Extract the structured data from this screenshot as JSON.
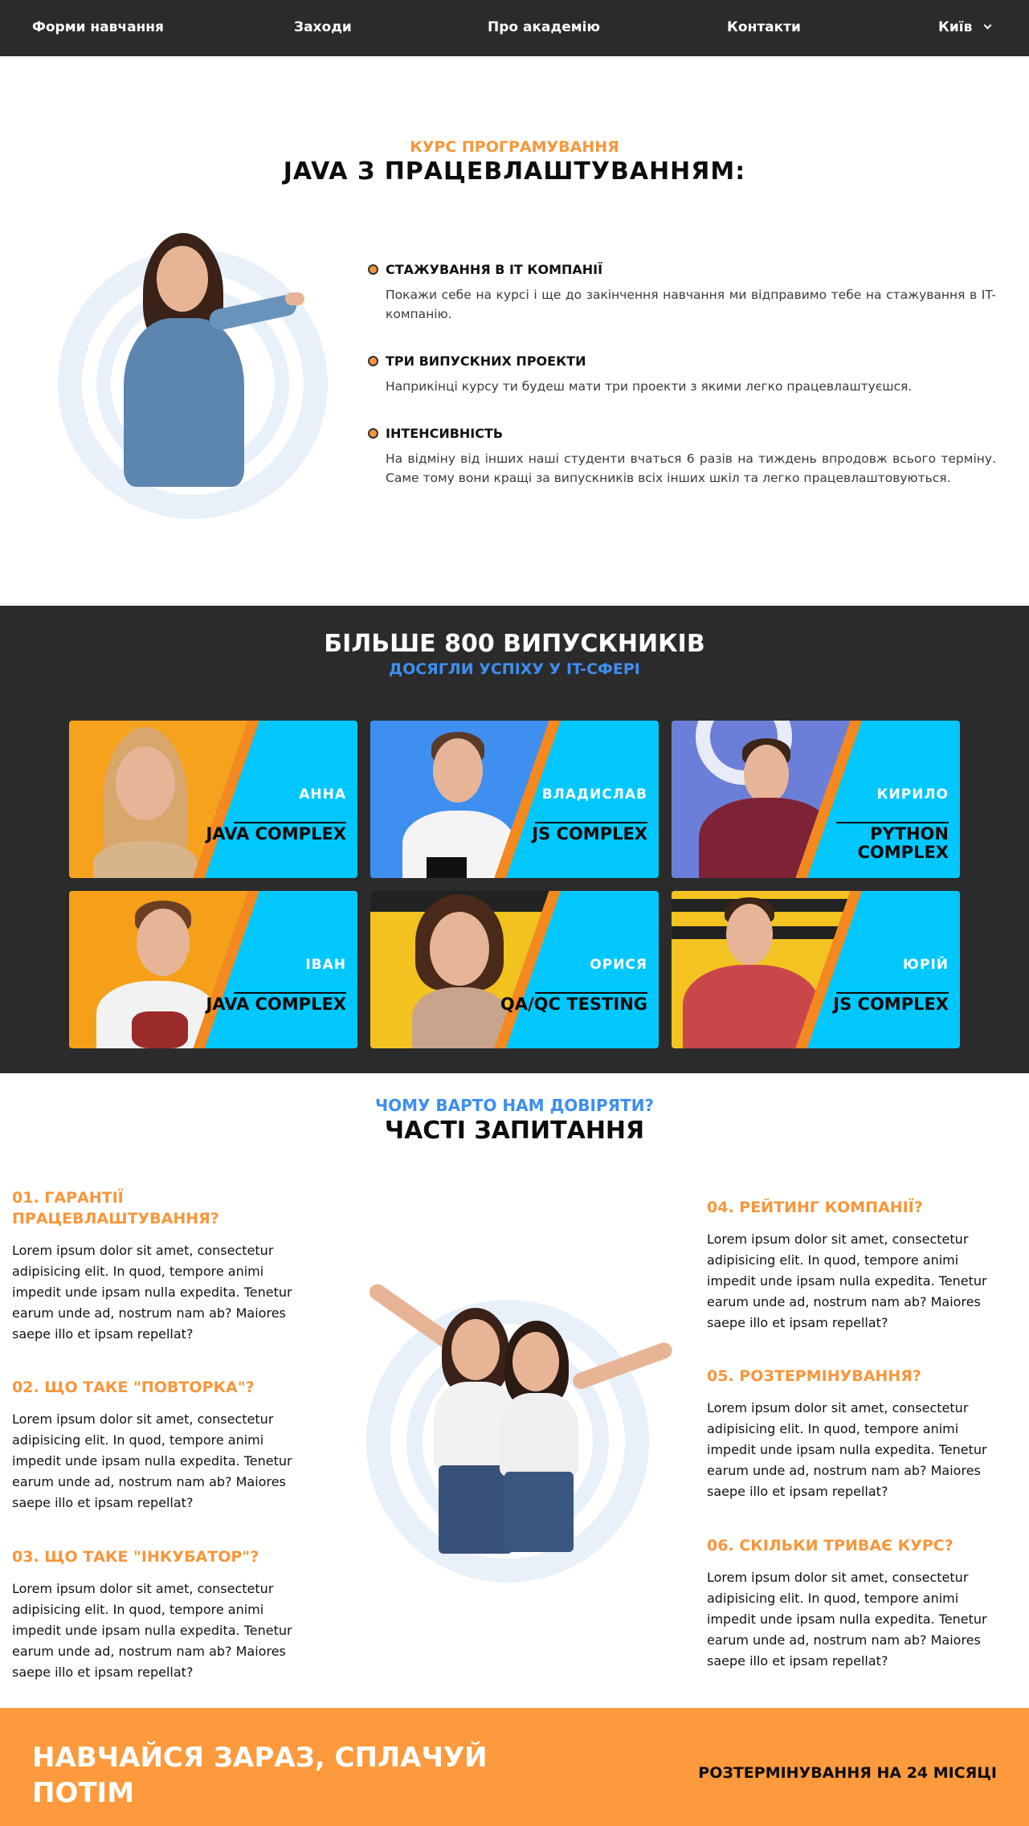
{
  "nav": {
    "items": [
      "Форми навчання",
      "Заходи",
      "Про академію",
      "Контакти"
    ],
    "city": "Київ"
  },
  "course": {
    "subtitle": "КУРС ПРОГРАМУВАННЯ",
    "title": "JAVA З ПРАЦЕВЛАШТУВАННЯМ:",
    "features": [
      {
        "title": "СТАЖУВАННЯ В IT КОМПАНІЇ",
        "text": "Покажи себе на курсі і ще до закінчення навчання ми відправимо тебе на стажування в IT-компанію."
      },
      {
        "title": "ТРИ ВИПУСКНИХ ПРОЕКТИ",
        "text": "Наприкінці курсу ти будеш мати три проекти з якими легко працевлаштуєшся."
      },
      {
        "title": "ІНТЕНСИВНІСТЬ",
        "text": "На відміну від інших наші студенти вчаться 6 разів на тиждень впродовж всього терміну. Саме тому вони кращі за випускників всіх інших шкіл та легко працевлаштовуються."
      }
    ]
  },
  "graduates": {
    "title": "БІЛЬШЕ 800 ВИПУСКНИКІВ",
    "subtitle": "ДОСЯГЛИ УСПІХУ У IT-СФЕРІ",
    "cards": [
      {
        "name": "АННА",
        "course": "JAVA COMPLEX",
        "bg": "#f6a21c"
      },
      {
        "name": "ВЛАДИСЛАВ",
        "course": "JS COMPLEX",
        "bg": "#3f8ff0"
      },
      {
        "name": "КИРИЛО",
        "course": "PYTHON COMPLEX",
        "bg": "#6c7fd8"
      },
      {
        "name": "ІВАН",
        "course": "JAVA COMPLEX",
        "bg": "#f5a018"
      },
      {
        "name": "ОРИСЯ",
        "course": "QA/QC TESTING",
        "bg": "#f2c21e"
      },
      {
        "name": "ЮРІЙ",
        "course": "JS COMPLEX",
        "bg": "#f3c421"
      }
    ]
  },
  "faq": {
    "subtitle": "ЧОМУ ВАРТО НАМ ДОВІРЯТИ?",
    "title": "ЧАСТІ ЗАПИТАННЯ",
    "items": [
      {
        "q": "01. ГАРАНТІЇ ПРАЦЕВЛАШТУВАННЯ?",
        "a": "Lorem ipsum dolor sit amet, consectetur adipisicing elit. In quod, tempore animi impedit unde ipsam nulla expedita. Tenetur earum unde ad, nostrum nam ab? Maiores saepe illo et ipsam repellat?"
      },
      {
        "q": "02. ЩО ТАКЕ \"ПОВТОРКА\"?",
        "a": "Lorem ipsum dolor sit amet, consectetur adipisicing elit. In quod, tempore animi impedit unde ipsam nulla expedita. Tenetur earum unde ad, nostrum nam ab? Maiores saepe illo et ipsam repellat?"
      },
      {
        "q": "03. ЩО ТАКЕ \"ІНКУБАТОР\"?",
        "a": "Lorem ipsum dolor sit amet, consectetur adipisicing elit. In quod, tempore animi impedit unde ipsam nulla expedita. Tenetur earum unde ad, nostrum nam ab? Maiores saepe illo et ipsam repellat?"
      },
      {
        "q": "04. РЕЙТИНГ КОМПАНІЇ?",
        "a": "Lorem ipsum dolor sit amet, consectetur adipisicing elit. In quod, tempore animi impedit unde ipsam nulla expedita. Tenetur earum unde ad, nostrum nam ab? Maiores saepe illo et ipsam repellat?"
      },
      {
        "q": "05. РОЗТЕРМІНУВАННЯ?",
        "a": "Lorem ipsum dolor sit amet, consectetur adipisicing elit. In quod, tempore animi impedit unde ipsam nulla expedita. Tenetur earum unde ad, nostrum nam ab? Maiores saepe illo et ipsam repellat?"
      },
      {
        "q": "06. СКІЛЬКИ ТРИВАЄ КУРС?",
        "a": "Lorem ipsum dolor sit amet, consectetur adipisicing elit. In quod, tempore animi impedit unde ipsam nulla expedita. Tenetur earum unde ad, nostrum nam ab? Maiores saepe illo et ipsam repellat?"
      }
    ]
  },
  "banner": {
    "title": "НАВЧАЙСЯ ЗАРАЗ, СПЛАЧУЙ ПОТІМ",
    "right": "РОЗТЕРМІНУВАННЯ НА 24 МІСЯЦІ"
  },
  "colors": {
    "accent_orange": "#f7963b",
    "accent_blue": "#3d8ef0",
    "dark": "#2b2b2b",
    "card_cyan": "#00c8ff"
  }
}
